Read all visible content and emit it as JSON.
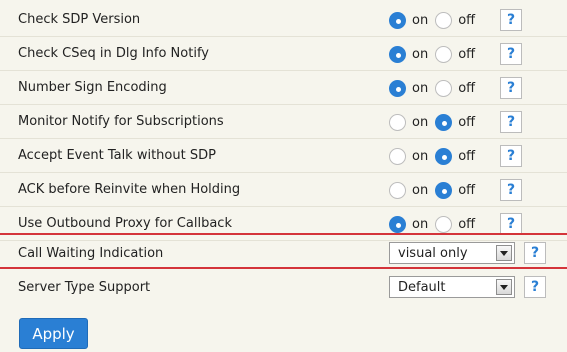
{
  "options": {
    "on_label": "on",
    "off_label": "off",
    "help_label": "?"
  },
  "settings": [
    {
      "label": "Check SDP Version",
      "value": "on"
    },
    {
      "label": "Check CSeq in Dlg Info Notify",
      "value": "on"
    },
    {
      "label": "Number Sign Encoding",
      "value": "on"
    },
    {
      "label": "Monitor Notify for Subscriptions",
      "value": "off"
    },
    {
      "label": "Accept Event Talk without SDP",
      "value": "off"
    },
    {
      "label": "ACK before Reinvite when Holding",
      "value": "off"
    },
    {
      "label": "Use Outbound Proxy for Callback",
      "value": "on"
    }
  ],
  "call_waiting": {
    "label": "Call Waiting Indication",
    "selected": "visual only"
  },
  "server_type": {
    "label": "Server Type Support",
    "selected": "Default"
  },
  "apply_label": "Apply",
  "colors": {
    "accent": "#2a7fd4",
    "highlight": "#d4343a",
    "background": "#f6f5ed"
  }
}
